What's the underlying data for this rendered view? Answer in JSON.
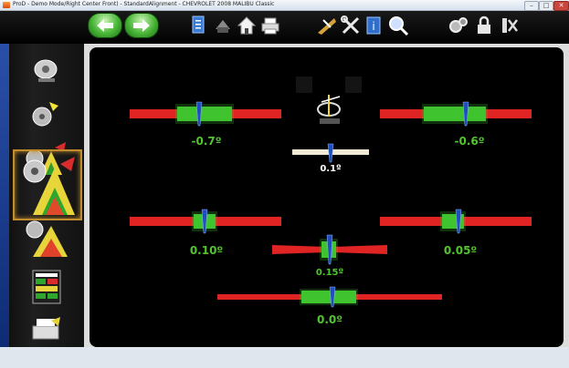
{
  "window": {
    "title": "ProD - Demo Mode/Right Center Front) - StandardAlignment - CHEVROLET 2008 MALIBU Classic",
    "min_glyph": "–",
    "max_glyph": "□",
    "close_glyph": "✕"
  },
  "toolbar": {
    "back_icon": "back-arrow-icon",
    "forward_icon": "forward-arrow-icon",
    "tools": [
      "vehicle-specs-icon",
      "print-icon",
      "home-icon",
      "printer-icon",
      "measure-icon",
      "tools-icon",
      "info-icon",
      "zoom-icon",
      "settings-gears-icon",
      "lock-icon",
      "alignment-tool-icon"
    ]
  },
  "sidebar": {
    "items": [
      {
        "name": "wheel-runout-icon"
      },
      {
        "name": "caster-swing-icon"
      },
      {
        "name": "rear-alignment-icon"
      },
      {
        "name": "front-alignment-icon",
        "selected": true
      },
      {
        "name": "front-adjust-icon"
      },
      {
        "name": "report-summary-icon"
      },
      {
        "name": "print-report-icon"
      }
    ]
  },
  "readings": {
    "left_camber": "-0.7º",
    "right_camber": "-0.6º",
    "center_top": "0.1º",
    "left_toe": "0.10º",
    "right_toe": "0.05º",
    "total_toe": "0.15º",
    "bottom": "0.0º"
  },
  "colors": {
    "in_spec": "#3fc42f",
    "out_of_spec": "#e02424",
    "reading_text": "#52c52e",
    "pointer": "#1f4fbf"
  }
}
